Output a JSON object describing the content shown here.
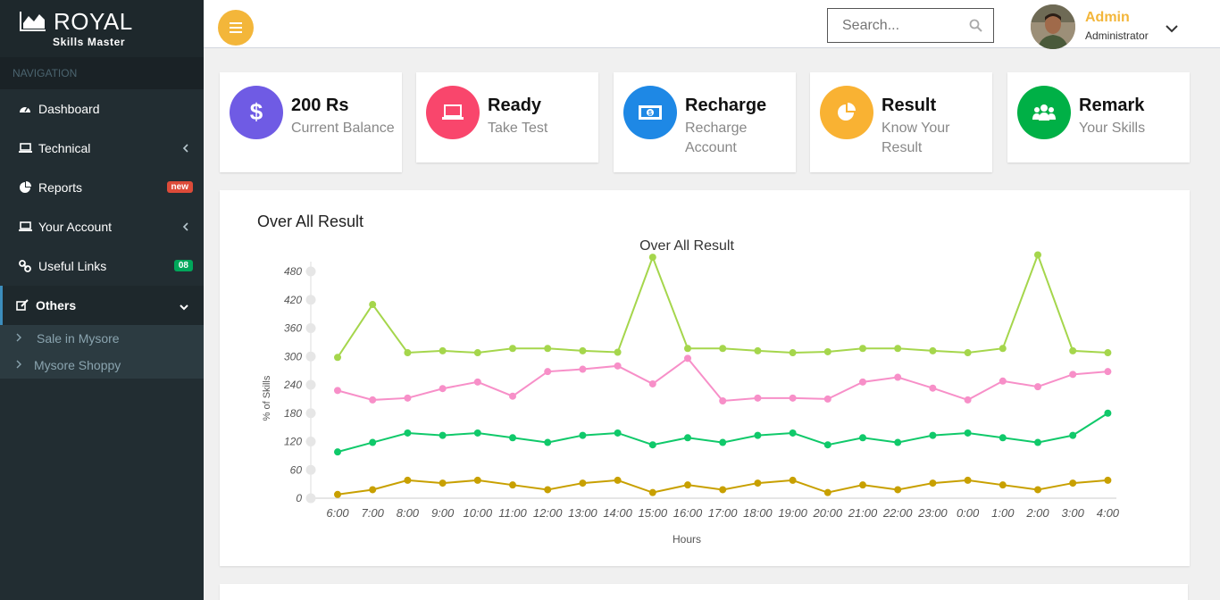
{
  "brand": {
    "title": "ROYAL",
    "subtitle": "Skills Master"
  },
  "navigation": {
    "header": "NAVIGATION",
    "items": [
      {
        "label": "Dashboard",
        "icon": "dashboard-icon"
      },
      {
        "label": "Technical",
        "icon": "laptop-icon"
      },
      {
        "label": "Reports",
        "icon": "pie-chart-icon",
        "badge": "new",
        "badge_color": "#dd4b39"
      },
      {
        "label": "Your Account",
        "icon": "laptop-icon"
      },
      {
        "label": "Useful Links",
        "icon": "link-icon",
        "badge": "08",
        "badge_color": "#00a65a"
      },
      {
        "label": "Others",
        "icon": "edit-icon"
      }
    ],
    "submenu": [
      "Sale in Mysore",
      "Mysore Shoppy"
    ]
  },
  "header": {
    "search_placeholder": "Search...",
    "user_name": "Admin",
    "user_role": "Administrator",
    "accent_color": "#f3b63a"
  },
  "cards": [
    {
      "value": "200 Rs",
      "label": "Current Balance",
      "icon": "dollar-icon",
      "color": "#6f5be4"
    },
    {
      "value": "Ready",
      "label": "Take Test",
      "icon": "laptop-icon",
      "color": "#f9466c"
    },
    {
      "value": "Recharge",
      "label": "Recharge Account",
      "icon": "money-icon",
      "color": "#1e88e5"
    },
    {
      "value": "Result",
      "label": "Know Your Result",
      "icon": "pie-chart-icon",
      "color": "#f9b233"
    },
    {
      "value": "Remark",
      "label": "Your Skills",
      "icon": "users-icon",
      "color": "#00b046"
    }
  ],
  "panel": {
    "title": "Over All Result"
  },
  "chart_data": {
    "type": "line",
    "title": "Over All Result",
    "xlabel": "Hours",
    "ylabel": "% of Skills",
    "ylim": [
      0,
      480
    ],
    "yticks": [
      0,
      60,
      120,
      180,
      240,
      300,
      360,
      420,
      480
    ],
    "categories": [
      "6:00",
      "7:00",
      "8:00",
      "9:00",
      "10:00",
      "11:00",
      "12:00",
      "13:00",
      "14:00",
      "15:00",
      "16:00",
      "17:00",
      "18:00",
      "19:00",
      "20:00",
      "21:00",
      "22:00",
      "23:00",
      "0:00",
      "1:00",
      "2:00",
      "3:00",
      "4:00"
    ],
    "grid": false,
    "legend": "none",
    "series": [
      {
        "color": "#a5d64c",
        "values": [
          298,
          410,
          308,
          312,
          308,
          317,
          317,
          312,
          309,
          510,
          317,
          317,
          312,
          308,
          310,
          317,
          317,
          312,
          308,
          317,
          515,
          312,
          308
        ]
      },
      {
        "color": "#f78fc8",
        "values": [
          228,
          208,
          212,
          232,
          246,
          216,
          268,
          273,
          280,
          242,
          296,
          206,
          212,
          212,
          210,
          246,
          256,
          233,
          208,
          248,
          236,
          262,
          268
        ]
      },
      {
        "color": "#10c96a",
        "values": [
          98,
          118,
          138,
          133,
          138,
          128,
          118,
          133,
          138,
          113,
          128,
          118,
          133,
          138,
          113,
          128,
          118,
          133,
          138,
          128,
          118,
          133,
          180
        ]
      },
      {
        "color": "#c8a000",
        "values": [
          8,
          18,
          38,
          32,
          38,
          28,
          18,
          32,
          38,
          12,
          28,
          18,
          32,
          38,
          12,
          28,
          18,
          32,
          38,
          28,
          18,
          32,
          38
        ]
      }
    ]
  }
}
